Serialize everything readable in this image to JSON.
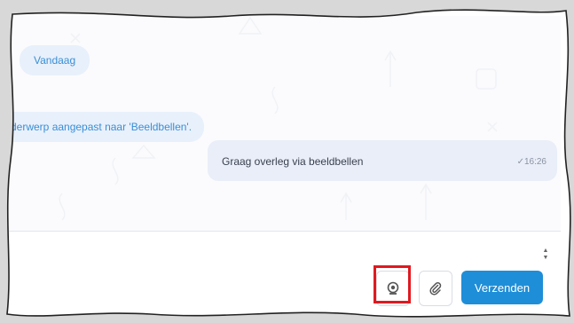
{
  "chat": {
    "day_label": "Vandaag",
    "system_message": "derwerp aangepast naar 'Beeldbellen'.",
    "messages": [
      {
        "text": "Graag overleg via beeldbellen",
        "time": "✓16:26"
      }
    ]
  },
  "composer": {
    "scroll_up": "▲",
    "scroll_down": "▼",
    "video_call_icon": "webcam-icon",
    "attach_icon": "paperclip-icon",
    "send_label": "Verzenden"
  },
  "colors": {
    "accent": "#1f8ed8",
    "highlight": "#e01920",
    "pill_bg": "#e8f0fb",
    "bubble_bg": "#e9eef8"
  }
}
